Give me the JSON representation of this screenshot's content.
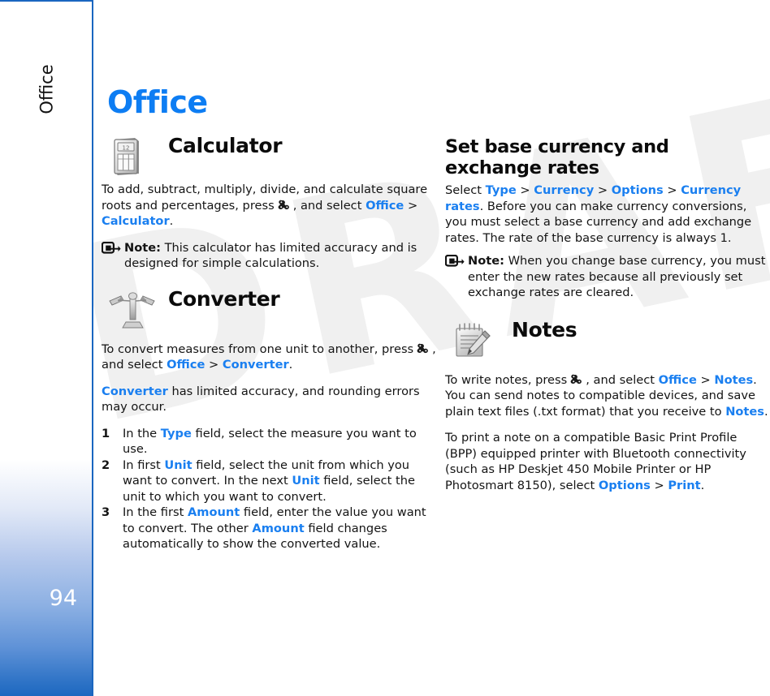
{
  "page": {
    "number": "94",
    "tab_label": "Office",
    "watermark": "DRAFT",
    "title": "Office",
    "link_color": "#1a7ff0",
    "title_color": "#0d7df3",
    "sidebar_accent": "#1c68c0"
  },
  "left_column": {
    "calculator": {
      "icon": "calculator-icon",
      "heading": "Calculator",
      "intro_part1": "To add, subtract, multiply, divide, and calculate square roots and percentages, press",
      "intro_part2": ", and select",
      "link_office": "Office",
      "separator": ">",
      "link_calculator": "Calculator",
      "period": ".",
      "note_label": "Note:",
      "note_text": "This calculator has limited accuracy and is designed for simple calculations."
    },
    "converter": {
      "icon": "scale-icon",
      "heading": "Converter",
      "intro_part1": "To convert measures from one unit to another, press",
      "intro_part2": ", and select",
      "link_office": "Office",
      "separator": ">",
      "link_converter": "Converter",
      "period": ".",
      "accuracy_link": "Converter",
      "accuracy_text": "has limited accuracy, and rounding errors may occur.",
      "steps": [
        {
          "num": "1",
          "segments": [
            {
              "t": "In the ",
              "k": "plain"
            },
            {
              "t": "Type",
              "k": "link"
            },
            {
              "t": " field, select the measure you want to use.",
              "k": "plain"
            }
          ]
        },
        {
          "num": "2",
          "segments": [
            {
              "t": "In first ",
              "k": "plain"
            },
            {
              "t": "Unit",
              "k": "link"
            },
            {
              "t": " field, select the unit from which you want to convert. In the next ",
              "k": "plain"
            },
            {
              "t": "Unit",
              "k": "link"
            },
            {
              "t": " field, select the unit to which you want to convert.",
              "k": "plain"
            }
          ]
        },
        {
          "num": "3",
          "segments": [
            {
              "t": "In the first ",
              "k": "plain"
            },
            {
              "t": "Amount",
              "k": "link"
            },
            {
              "t": " field, enter the value you want to convert. The other ",
              "k": "plain"
            },
            {
              "t": "Amount",
              "k": "link"
            },
            {
              "t": " field changes automatically to show the converted value.",
              "k": "plain"
            }
          ]
        }
      ]
    }
  },
  "right_column": {
    "currency": {
      "heading": "Set base currency and exchange rates",
      "select_word": "Select",
      "link_type": "Type",
      "link_currency": "Currency",
      "link_options": "Options",
      "link_currency_rates": "Currency rates",
      "separator": ">",
      "period": ".",
      "body": "Before you can make currency conversions, you must select a base currency and add exchange rates. The rate of the base currency is always 1.",
      "note_label": "Note:",
      "note_text": "When you change base currency, you must enter the new rates because all previously set exchange rates are cleared."
    },
    "notes": {
      "icon": "notepad-pen-icon",
      "heading": "Notes",
      "intro_part1": "To write notes, press",
      "intro_part2": ", and select",
      "link_office": "Office",
      "separator": ">",
      "link_notes": "Notes",
      "intro_part3": ". You can send notes to compatible devices, and save plain text files (.txt format) that you receive to",
      "link_notes2": "Notes",
      "period": ".",
      "print_text": "To print a note on a compatible Basic Print Profile (BPP) equipped printer with Bluetooth connectivity (such as HP Deskjet 450 Mobile Printer or HP Photosmart 8150), select",
      "link_options": "Options",
      "separator2": ">",
      "link_print": "Print",
      "period2": "."
    }
  }
}
